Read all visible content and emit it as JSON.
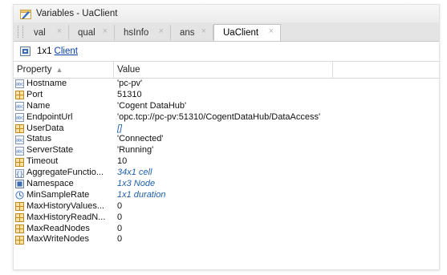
{
  "window": {
    "title": "Variables - UaClient"
  },
  "tabs": [
    {
      "label": "val",
      "close": "×"
    },
    {
      "label": "qual",
      "close": "×"
    },
    {
      "label": "hsInfo",
      "close": "×"
    },
    {
      "label": "ans",
      "close": "×"
    },
    {
      "label": "UaClient",
      "close": "×"
    }
  ],
  "subheader": {
    "dims": "1x1",
    "link": "Client"
  },
  "table": {
    "headers": {
      "property": "Property",
      "value": "Value",
      "sort_glyph": "▲"
    },
    "rows": [
      {
        "property": "Hostname",
        "value": "'pc-pv'",
        "icon": "char-icon",
        "obj": false
      },
      {
        "property": "Port",
        "value": "51310",
        "icon": "numeric-icon",
        "obj": false
      },
      {
        "property": "Name",
        "value": "'Cogent DataHub'",
        "icon": "char-icon",
        "obj": false
      },
      {
        "property": "EndpointUrl",
        "value": "'opc.tcp://pc-pv:51310/CogentDataHub/DataAccess'",
        "icon": "char-icon",
        "obj": false
      },
      {
        "property": "UserData",
        "value": "[]",
        "icon": "numeric-icon",
        "obj": true
      },
      {
        "property": "Status",
        "value": "'Connected'",
        "icon": "char-icon",
        "obj": false
      },
      {
        "property": "ServerState",
        "value": "'Running'",
        "icon": "char-icon",
        "obj": false
      },
      {
        "property": "Timeout",
        "value": "10",
        "icon": "numeric-icon",
        "obj": false
      },
      {
        "property": "AggregateFunctio...",
        "value": "34x1 cell",
        "icon": "cell-icon",
        "obj": true
      },
      {
        "property": "Namespace",
        "value": "1x3 Node",
        "icon": "object-icon",
        "obj": true
      },
      {
        "property": "MinSampleRate",
        "value": "1x1 duration",
        "icon": "duration-icon",
        "obj": true
      },
      {
        "property": "MaxHistoryValues...",
        "value": "0",
        "icon": "numeric-icon",
        "obj": false
      },
      {
        "property": "MaxHistoryReadN...",
        "value": "0",
        "icon": "numeric-icon",
        "obj": false
      },
      {
        "property": "MaxReadNodes",
        "value": "0",
        "icon": "numeric-icon",
        "obj": false
      },
      {
        "property": "MaxWriteNodes",
        "value": "0",
        "icon": "numeric-icon",
        "obj": false
      }
    ]
  },
  "colors": {
    "link": "#0a3fa5",
    "object_value": "#1f5fa8",
    "numeric_icon": "#d59b2b",
    "char_icon": "#4a79b8"
  }
}
